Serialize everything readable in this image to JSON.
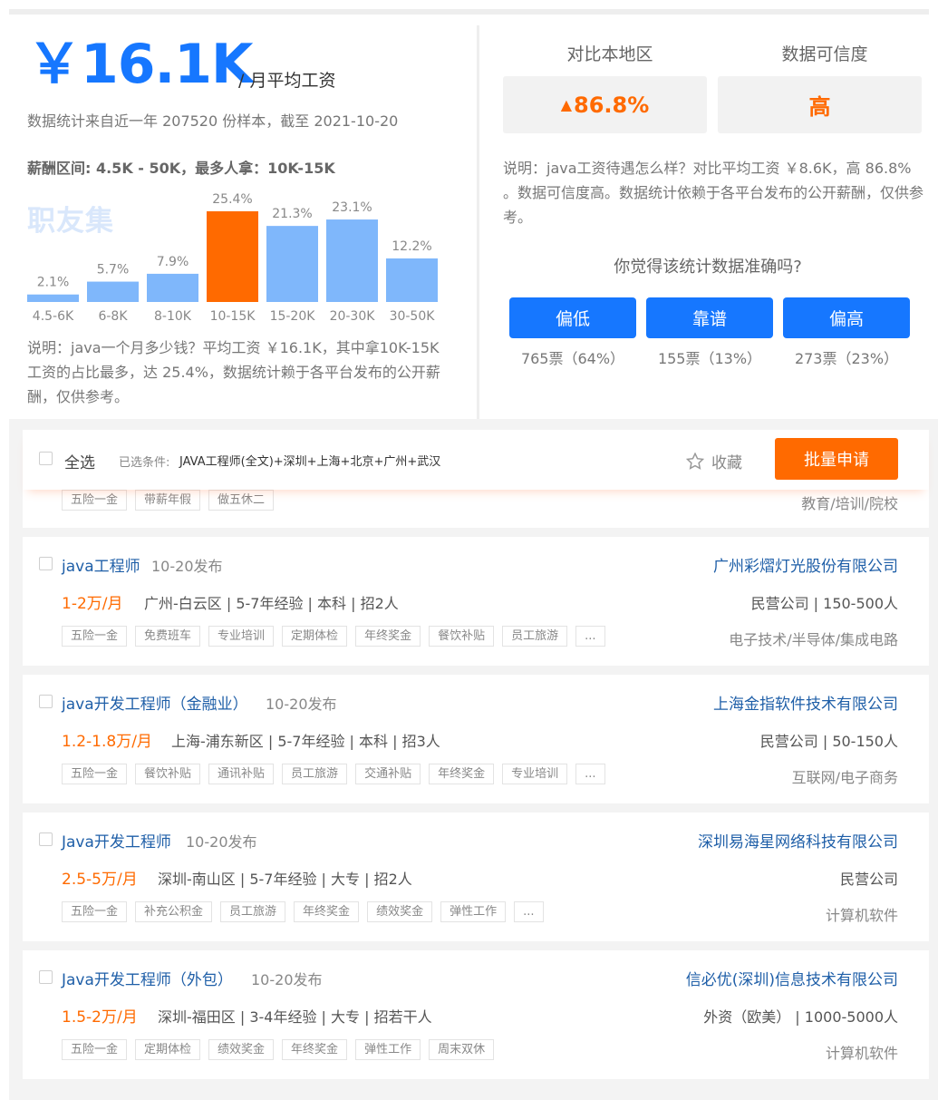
{
  "salary": {
    "average": "￥16.1K",
    "unit": "/ 月平均工资",
    "sample_text": "数据统计来自近一年 207520 份样本，截至 2021-10-20",
    "range_text": "薪酬区间: 4.5K - 50K，最多人拿：10K-15K",
    "watermark": "职友集",
    "note": "说明：java一个月多少钱？平均工资 ￥16.1K，其中拿10K-15K 工资的占比最多，达 25.4%，数据统计赖于各平台发布的公开薪酬，仅供参考。"
  },
  "chart_data": {
    "type": "bar",
    "categories": [
      "4.5-6K",
      "6-8K",
      "8-10K",
      "10-15K",
      "15-20K",
      "20-30K",
      "30-50K"
    ],
    "values": [
      2.1,
      5.7,
      7.9,
      25.4,
      21.3,
      23.1,
      12.2
    ],
    "labels": [
      "2.1%",
      "5.7%",
      "7.9%",
      "25.4%",
      "21.3%",
      "23.1%",
      "12.2%"
    ],
    "highlight_index": 3,
    "colors": {
      "bar": "#7fb7fb",
      "highlight": "#ff6a00"
    },
    "title": "",
    "xlabel": "",
    "ylabel": "",
    "ylim": [
      0,
      25.4
    ]
  },
  "compare": {
    "region_label": "对比本地区",
    "region_value": "86.8%",
    "credibility_label": "数据可信度",
    "credibility_value": "高",
    "note": "说明：java工资待遇怎么样？对比平均工资 ￥8.6K，高 86.8% 。数据可信度高。数据统计依赖于各平台发布的公开薪酬，仅供参考。"
  },
  "vote": {
    "question": "你觉得该统计数据准确吗?",
    "options": [
      {
        "label": "偏低",
        "count": "765票（64%）"
      },
      {
        "label": "靠谱",
        "count": "155票（13%）"
      },
      {
        "label": "偏高",
        "count": "273票（23%）"
      }
    ]
  },
  "toolbar": {
    "select_all": "全选",
    "cond_label": "已选条件:",
    "conditions": "JAVA工程师(全文)+深圳+上海+北京+广州+武汉",
    "favorite": "收藏",
    "batch_apply": "批量申请"
  },
  "partial_job": {
    "tags": [
      "五险一金",
      "带薪年假",
      "做五休二"
    ],
    "industry": "教育/培训/院校"
  },
  "jobs": [
    {
      "title": "java工程师",
      "date": "10-20发布",
      "salary": "1-2万/月",
      "info": "广州-白云区 | 5-7年经验 | 本科 | 招2人",
      "company": "广州彩熠灯光股份有限公司",
      "company_info": "民营公司 | 150-500人",
      "industry": "电子技术/半导体/集成电路",
      "tags": [
        "五险一金",
        "免费班车",
        "专业培训",
        "定期体检",
        "年终奖金",
        "餐饮补贴",
        "员工旅游",
        "..."
      ]
    },
    {
      "title": "java开发工程师（金融业）",
      "date": "10-20发布",
      "salary": "1.2-1.8万/月",
      "info": "上海-浦东新区 | 5-7年经验 | 本科 | 招3人",
      "company": "上海金指软件技术有限公司",
      "company_info": "民营公司 | 50-150人",
      "industry": "互联网/电子商务",
      "tags": [
        "五险一金",
        "餐饮补贴",
        "通讯补贴",
        "员工旅游",
        "交通补贴",
        "年终奖金",
        "专业培训",
        "..."
      ]
    },
    {
      "title": "Java开发工程师",
      "date": "10-20发布",
      "salary": "2.5-5万/月",
      "info": "深圳-南山区 | 5-7年经验 | 大专 | 招2人",
      "company": "深圳易海星网络科技有限公司",
      "company_info": "民营公司",
      "industry": "计算机软件",
      "tags": [
        "五险一金",
        "补充公积金",
        "员工旅游",
        "年终奖金",
        "绩效奖金",
        "弹性工作",
        "..."
      ]
    },
    {
      "title": "Java开发工程师（外包）",
      "date": "10-20发布",
      "salary": "1.5-2万/月",
      "info": "深圳-福田区 | 3-4年经验 | 大专 | 招若干人",
      "company": "信必优(深圳)信息技术有限公司",
      "company_info": "外资（欧美） | 1000-5000人",
      "industry": "计算机软件",
      "tags": [
        "五险一金",
        "定期体检",
        "绩效奖金",
        "年终奖金",
        "弹性工作",
        "周末双休"
      ]
    }
  ]
}
